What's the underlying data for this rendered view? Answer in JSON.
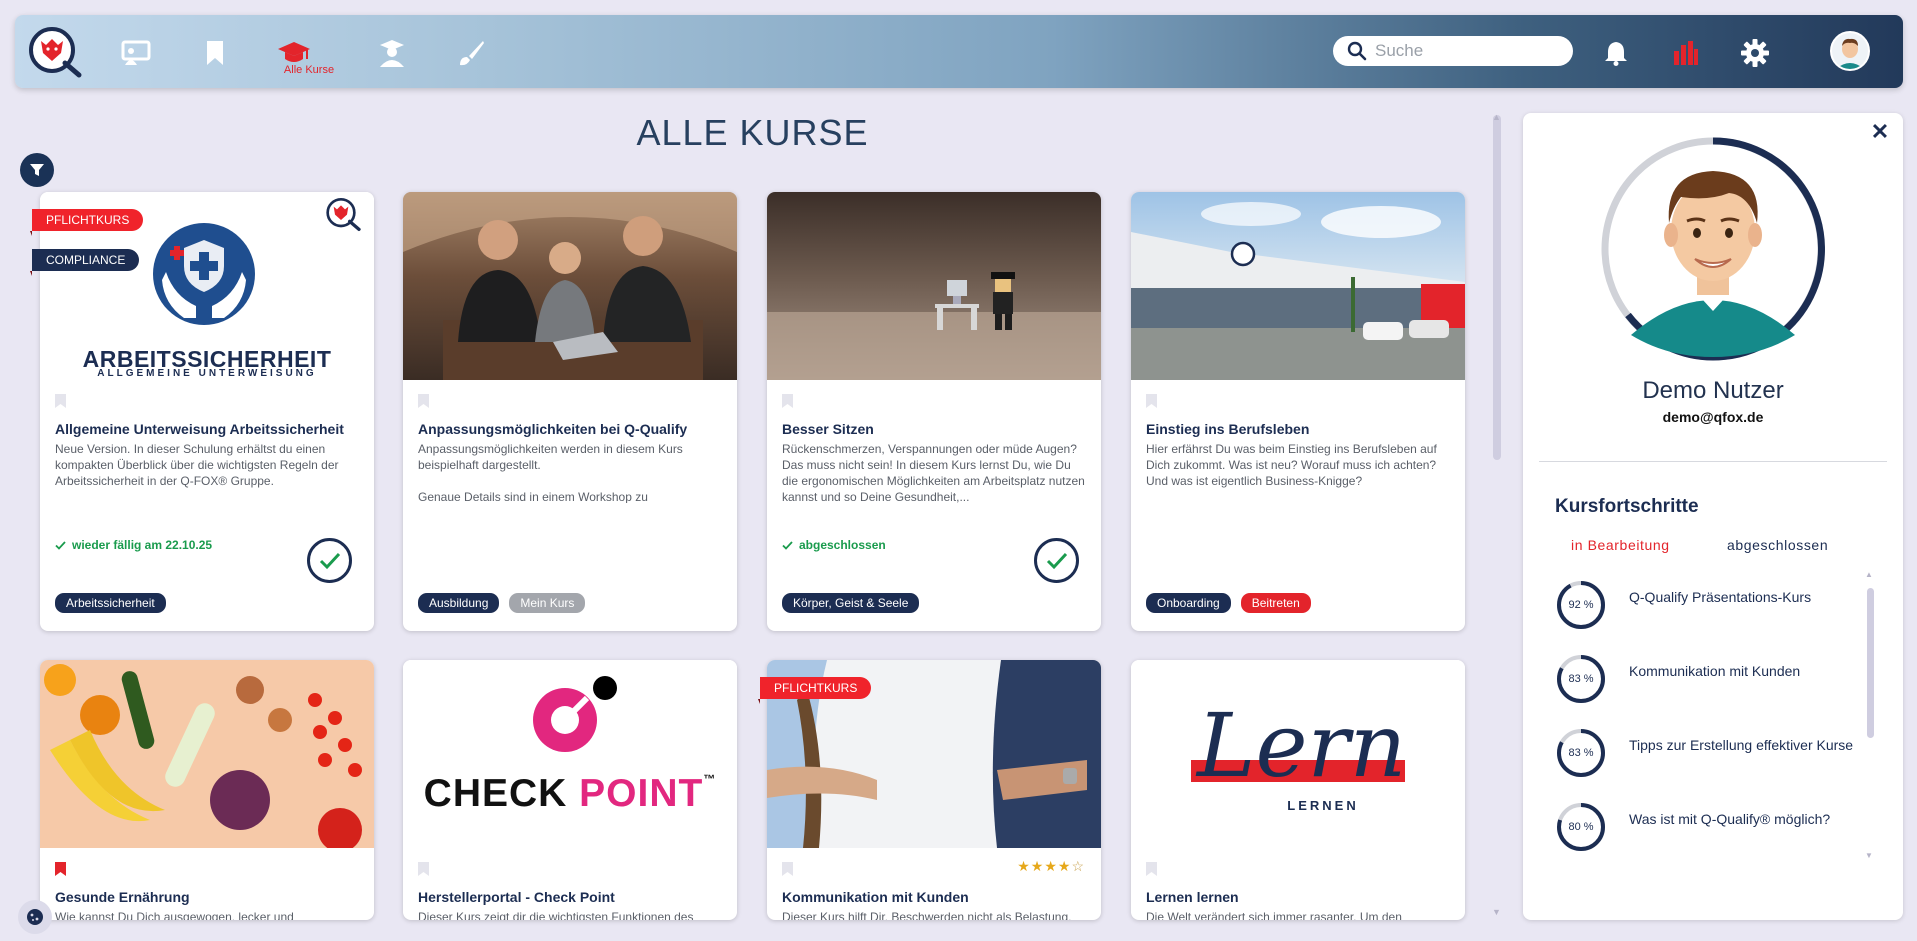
{
  "nav": {
    "active_label": "Alle Kurse",
    "icons": [
      "presentation-icon",
      "bookmark-icon",
      "graduation-cap-icon",
      "teacher-icon",
      "brush-icon"
    ],
    "search_placeholder": "Suche"
  },
  "page": {
    "title": "ALLE KURSE"
  },
  "cards": [
    {
      "ribbons": [
        "PFLICHTKURS",
        "COMPLIANCE"
      ],
      "logo_line1": "ARBEITSSICHERHEIT",
      "logo_line2": "ALLGEMEINE UNTERWEISUNG",
      "title": "Allgemeine Unterweisung Arbeitssicherheit",
      "desc": "Neue Version. In dieser Schulung erhältst du einen kompakten Überblick über die wichtigsten Regeln der Arbeitssicherheit in der Q-FOX® Gruppe.",
      "status": "wieder fällig am 22.10.25",
      "tags": [
        "Arbeitssicherheit"
      ]
    },
    {
      "title": "Anpassungsmöglichkeiten bei Q-Qualify",
      "desc": "Anpassungsmöglichkeiten werden in diesem Kurs beispielhaft dargestellt.",
      "desc2": "Genaue Details sind in einem Workshop zu",
      "tags": [
        "Ausbildung",
        "Mein Kurs"
      ]
    },
    {
      "title": "Besser Sitzen",
      "desc": "Rückenschmerzen, Verspannungen oder müde Augen? Das muss nicht sein! In diesem Kurs lernst Du, wie Du die ergonomischen Möglichkeiten am Arbeitsplatz nutzen kannst und so Deine Gesundheit,...",
      "status": "abgeschlossen",
      "tags": [
        "Körper, Geist & Seele"
      ]
    },
    {
      "title": "Einstieg ins Berufsleben",
      "desc": "Hier erfährst Du was beim Einstieg ins Berufsleben auf Dich zukommt. Was ist neu? Worauf muss ich achten? Und was ist eigentlich Business-Knigge?",
      "tags": [
        "Onboarding",
        "Beitreten"
      ]
    },
    {
      "title": "Gesunde Ernährung",
      "desc": "Wie kannst Du Dich ausgewogen, lecker und"
    },
    {
      "logo_text1": "CHECK",
      "logo_text2": "POINT",
      "logo_tm": "™",
      "title": "Herstellerportal - Check Point",
      "desc": "Dieser Kurs zeigt dir die wichtigsten Funktionen des"
    },
    {
      "ribbons": [
        "PFLICHTKURS"
      ],
      "rating": 4,
      "title": "Kommunikation mit Kunden",
      "desc": "Dieser Kurs hilft Dir, Beschwerden nicht als Belastung,"
    },
    {
      "logo_script": "Lernen",
      "logo_caption": "LERNEN",
      "title": "Lernen lernen",
      "desc": "Die Welt verändert sich immer rasanter. Um den"
    }
  ],
  "profile": {
    "name": "Demo Nutzer",
    "email": "demo@qfox.de",
    "progress_title": "Kursfortschritte",
    "tabs": [
      "in Bearbeitung",
      "abgeschlossen"
    ],
    "items": [
      {
        "pct_label": "92 %",
        "pct": 92,
        "label": "Q-Qualify Präsentations-Kurs"
      },
      {
        "pct_label": "83 %",
        "pct": 83,
        "label": "Kommunikation mit Kunden"
      },
      {
        "pct_label": "83 %",
        "pct": 83,
        "label": "Tipps zur Erstellung effektiver Kurse"
      },
      {
        "pct_label": "80 %",
        "pct": 80,
        "label": "Was ist mit Q-Qualify® möglich?"
      }
    ]
  },
  "colors": {
    "navy": "#1c2d52",
    "red": "#e3242b",
    "green": "#1a9b4d"
  }
}
